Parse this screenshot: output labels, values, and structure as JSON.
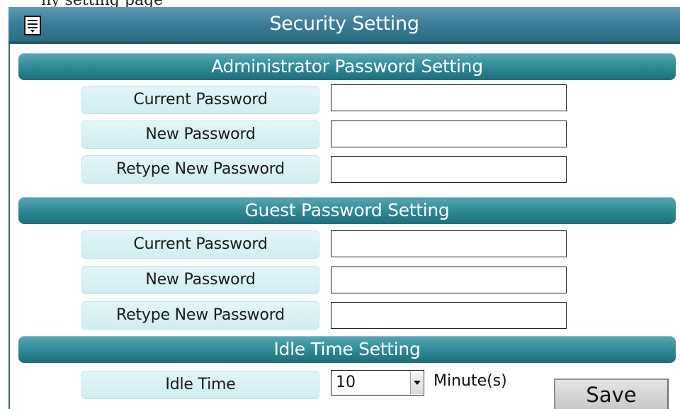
{
  "top_strip": {
    "partial_text": "ny setting page"
  },
  "title_bar": {
    "title": "Security Setting",
    "icon": "menu-icon"
  },
  "sections": {
    "admin": {
      "header": "Administrator Password Setting",
      "fields": [
        {
          "label": "Current Password",
          "value": ""
        },
        {
          "label": "New Password",
          "value": ""
        },
        {
          "label": "Retype New Password",
          "value": ""
        }
      ]
    },
    "guest": {
      "header": "Guest Password Setting",
      "fields": [
        {
          "label": "Current Password",
          "value": ""
        },
        {
          "label": "New Password",
          "value": ""
        },
        {
          "label": "Retype New Password",
          "value": ""
        }
      ]
    },
    "idle": {
      "header": "Idle Time Setting",
      "label": "Idle Time",
      "selected_value": "10",
      "unit": "Minute(s)"
    }
  },
  "actions": {
    "save_label": "Save"
  },
  "colors": {
    "title_bar": "#3d7f99",
    "section_header": "#2f8a97",
    "label_bg": "#d8f1f4"
  }
}
